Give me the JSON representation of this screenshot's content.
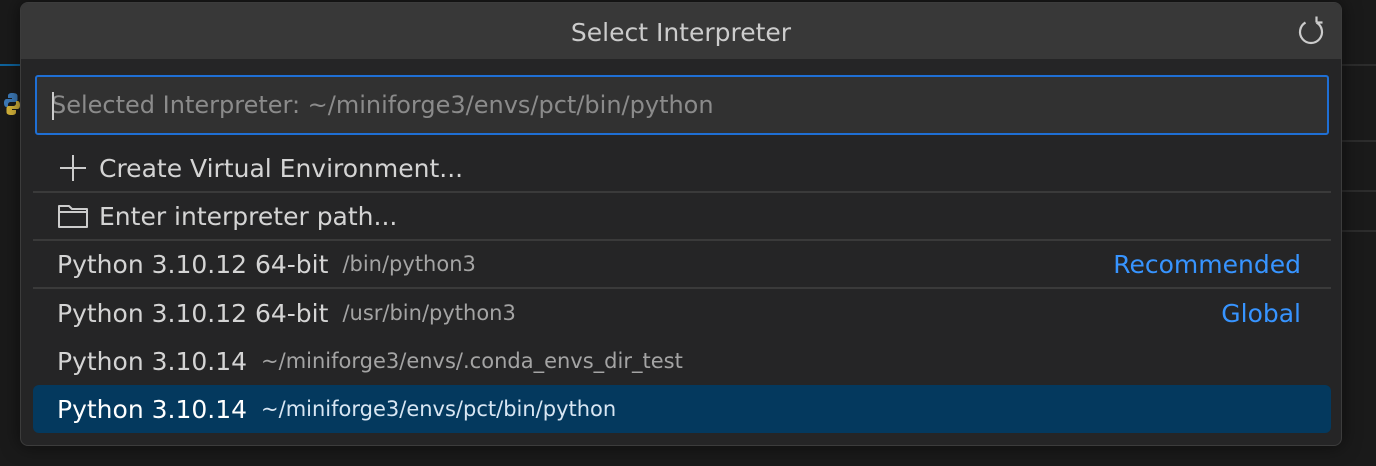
{
  "header": {
    "title": "Select Interpreter"
  },
  "search": {
    "placeholder": "Selected Interpreter: ~/miniforge3/envs/pct/bin/python",
    "value": ""
  },
  "actions": [
    {
      "label": "Create Virtual Environment...",
      "icon": "plus-icon"
    },
    {
      "label": "Enter interpreter path...",
      "icon": "folder-icon"
    }
  ],
  "interpreters": [
    {
      "name": "Python 3.10.12 64-bit",
      "path": "/bin/python3",
      "tag": "Recommended"
    },
    {
      "name": "Python 3.10.12 64-bit",
      "path": "/usr/bin/python3",
      "tag": "Global"
    },
    {
      "name": "Python 3.10.14",
      "path": "~/miniforge3/envs/.conda_envs_dir_test",
      "tag": ""
    },
    {
      "name": "Python 3.10.14",
      "path": "~/miniforge3/envs/pct/bin/python",
      "tag": "",
      "selected": true
    }
  ],
  "colors": {
    "accent": "#1f6fd4",
    "tag": "#3794ff",
    "selected_row": "#04395e"
  }
}
